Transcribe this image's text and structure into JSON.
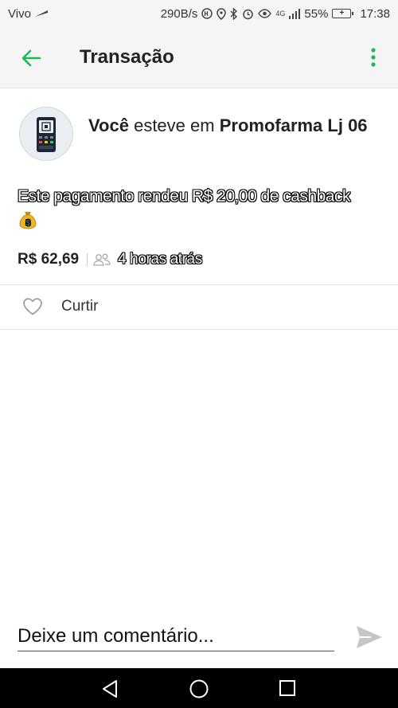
{
  "status_bar": {
    "carrier": "Vivo",
    "speed": "290B/s",
    "network": "4G",
    "battery": "55%",
    "time": "17:38"
  },
  "app_bar": {
    "title": "Transação",
    "back_icon": "arrow-left-icon",
    "menu_icon": "more-vert-icon",
    "accent_color": "#1db954"
  },
  "transaction": {
    "avatar_icon": "card-terminal-icon",
    "actor": "Você",
    "verb": "esteve em",
    "merchant": "Promofarma Lj 06",
    "message": "Este pagamento rendeu R$ 20,00 de cashback",
    "message_emoji": "💰",
    "amount": "R$ 62,69",
    "visibility_icon": "people-icon",
    "time_ago": "4 horas atrás"
  },
  "actions": {
    "like_label": "Curtir",
    "like_icon": "heart-outline-icon"
  },
  "comment": {
    "placeholder": "Deixe um comentário...",
    "send_icon": "send-icon"
  },
  "nav_bar": {
    "back_icon": "triangle-back-icon",
    "home_icon": "circle-home-icon",
    "recent_icon": "square-recents-icon"
  }
}
